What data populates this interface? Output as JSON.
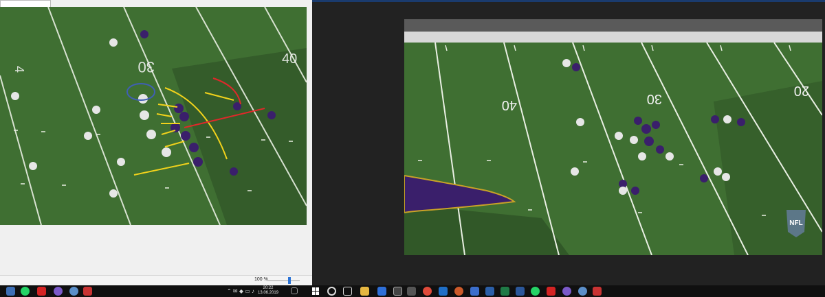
{
  "left_window": {
    "field_numbers": {
      "thirty": "30",
      "forty_rotated": "40"
    },
    "zoom_label": "100 %",
    "clock_time": "20:22",
    "clock_date": "13.06.2019"
  },
  "right_window": {
    "field_numbers": {
      "forty": "40",
      "thirty": "30",
      "twenty_partial": "20"
    },
    "watermark": "NFL"
  },
  "colors": {
    "field_green": "#3f6f32",
    "dark_field": "#2c4d24",
    "ravens_purple": "#3a1f6b",
    "raiders_white": "#e6e6e6",
    "annotation_yellow": "#f2d21b",
    "annotation_red": "#e0282a",
    "taskbar": "#101010"
  },
  "icons": [
    "windows-start-icon",
    "search-icon",
    "task-view-icon",
    "file-explorer-icon",
    "store-icon",
    "calculator-icon",
    "chrome-icon",
    "outlook-icon",
    "whatsapp-icon",
    "excel-icon",
    "word-icon",
    "pdf-icon",
    "media-player-icon"
  ]
}
